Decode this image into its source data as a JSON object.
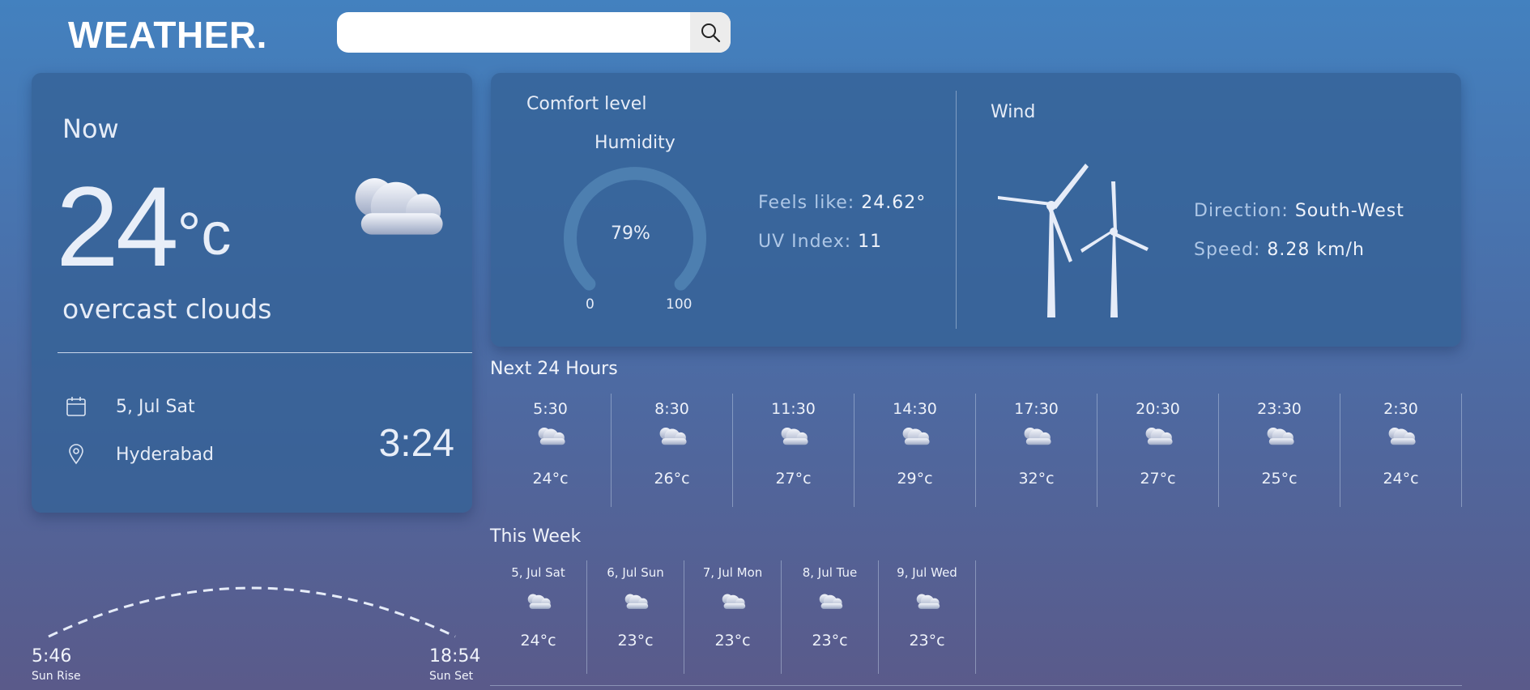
{
  "header": {
    "logo": "WEATHER.",
    "search": {
      "value": "",
      "placeholder": ""
    }
  },
  "now": {
    "label": "Now",
    "temperature": "24",
    "unit": "°c",
    "description": "overcast clouds",
    "date": "5, Jul Sat",
    "location": "Hyderabad",
    "time": "3:24",
    "icon": "overcast-clouds-icon"
  },
  "comfort": {
    "title": "Comfort level",
    "humidity_label": "Humidity",
    "humidity_value": "79%",
    "humidity_fraction": 0.79,
    "gauge_min": "0",
    "gauge_max": "100",
    "feels_like_label": "Feels like:",
    "feels_like_value": "24.62°",
    "uv_label": "UV Index:",
    "uv_value": "11"
  },
  "wind": {
    "title": "Wind",
    "direction_label": "Direction:",
    "direction_value": "South-West",
    "speed_label": "Speed:",
    "speed_value": "8.28 km/h",
    "icon": "wind-turbine-icon"
  },
  "hourly": {
    "title": "Next 24 Hours",
    "items": [
      {
        "time": "5:30",
        "temp": "24°c"
      },
      {
        "time": "8:30",
        "temp": "26°c"
      },
      {
        "time": "11:30",
        "temp": "27°c"
      },
      {
        "time": "14:30",
        "temp": "29°c"
      },
      {
        "time": "17:30",
        "temp": "32°c"
      },
      {
        "time": "20:30",
        "temp": "27°c"
      },
      {
        "time": "23:30",
        "temp": "25°c"
      },
      {
        "time": "2:30",
        "temp": "24°c"
      }
    ]
  },
  "week": {
    "title": "This Week",
    "items": [
      {
        "day": "5, Jul Sat",
        "temp": "24°c"
      },
      {
        "day": "6, Jul Sun",
        "temp": "23°c"
      },
      {
        "day": "7, Jul Mon",
        "temp": "23°c"
      },
      {
        "day": "8, Jul Tue",
        "temp": "23°c"
      },
      {
        "day": "9, Jul Wed",
        "temp": "23°c"
      }
    ]
  },
  "sun": {
    "sunrise_time": "5:46",
    "sunrise_label": "Sun Rise",
    "sunset_time": "18:54",
    "sunset_label": "Sun Set"
  },
  "colors": {
    "accent": "#4a86c0",
    "card": "#3a6496"
  }
}
